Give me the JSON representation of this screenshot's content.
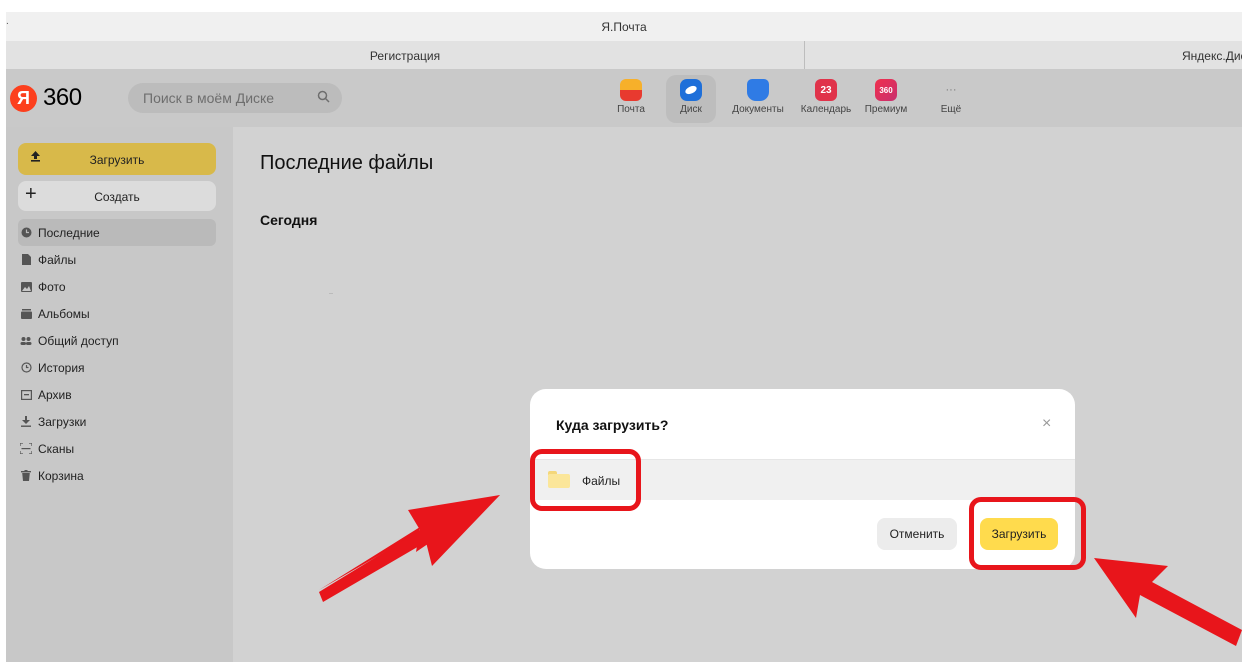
{
  "window": {
    "title": "Я.Почта"
  },
  "tabs": [
    {
      "label": "Регистрация"
    },
    {
      "label": "Яндекс.Диск"
    }
  ],
  "header": {
    "logo": {
      "ya": "Я",
      "brand": "360"
    },
    "search_placeholder": "Поиск в моём Диске",
    "services": [
      {
        "label": "Почта",
        "icon": "mail-icon",
        "color": "#f5a623"
      },
      {
        "label": "Диск",
        "icon": "disk-icon",
        "color": "#1e6fd9",
        "active": true
      },
      {
        "label": "Документы",
        "icon": "documents-icon",
        "color": "#2f7be5"
      },
      {
        "label": "Календарь",
        "icon": "calendar-icon",
        "color": "#e0334a",
        "badge": "23"
      },
      {
        "label": "Премиум",
        "icon": "premium-icon",
        "color": "#e8315b",
        "badge": "360"
      },
      {
        "label": "Ещё",
        "icon": "more-icon",
        "glyph": "···"
      }
    ]
  },
  "sidebar": {
    "upload_label": "Загрузить",
    "create_label": "Создать",
    "items": [
      {
        "label": "Последние",
        "icon": "clock-icon",
        "active": true
      },
      {
        "label": "Файлы",
        "icon": "file-icon"
      },
      {
        "label": "Фото",
        "icon": "photo-icon"
      },
      {
        "label": "Альбомы",
        "icon": "albums-icon"
      },
      {
        "label": "Общий доступ",
        "icon": "shared-icon"
      },
      {
        "label": "История",
        "icon": "history-icon"
      },
      {
        "label": "Архив",
        "icon": "archive-icon"
      },
      {
        "label": "Загрузки",
        "icon": "downloads-icon"
      },
      {
        "label": "Сканы",
        "icon": "scans-icon"
      },
      {
        "label": "Корзина",
        "icon": "trash-icon"
      }
    ]
  },
  "main": {
    "title": "Последние файлы",
    "section": "Сегодня"
  },
  "dialog": {
    "title": "Куда загрузить?",
    "close_glyph": "×",
    "folder_label": "Файлы",
    "cancel_label": "Отменить",
    "confirm_label": "Загрузить"
  },
  "colors": {
    "accent": "#ffdb4d",
    "highlight": "#e8151b",
    "brand": "#fc3f1d"
  }
}
